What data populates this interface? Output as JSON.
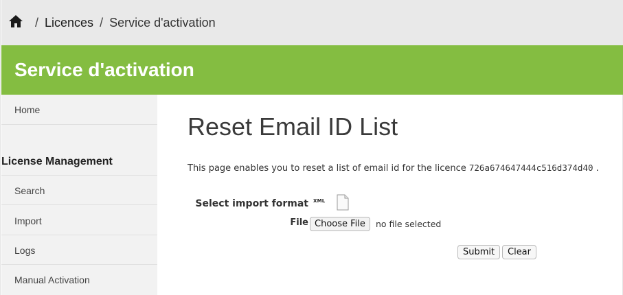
{
  "breadcrumb": {
    "home_icon": "home-icon",
    "separator": "/",
    "items": [
      {
        "label": "Licences"
      },
      {
        "label": "Service d'activation"
      }
    ]
  },
  "banner": {
    "title": "Service d'activation"
  },
  "sidebar": {
    "items": [
      {
        "label": "Home"
      },
      {
        "label": "License Management"
      },
      {
        "label": "Search"
      },
      {
        "label": "Import"
      },
      {
        "label": "Logs"
      },
      {
        "label": "Manual Activation"
      }
    ]
  },
  "main": {
    "title": "Reset Email ID List",
    "description_prefix": "This page enables you to reset a list of email id for the licence",
    "licence_id": "726a674647444c516d374d40",
    "description_suffix": ".",
    "format_label": "Select import format",
    "format_icon_text": "XML",
    "file_label": "File",
    "file_button": "Choose File",
    "file_status": "no file selected",
    "submit_label": "Submit",
    "clear_label": "Clear"
  },
  "colors": {
    "banner": "#84bd41",
    "breadcrumb_bg": "#e9e9e9",
    "sidebar_bg": "#f2f2f2"
  }
}
